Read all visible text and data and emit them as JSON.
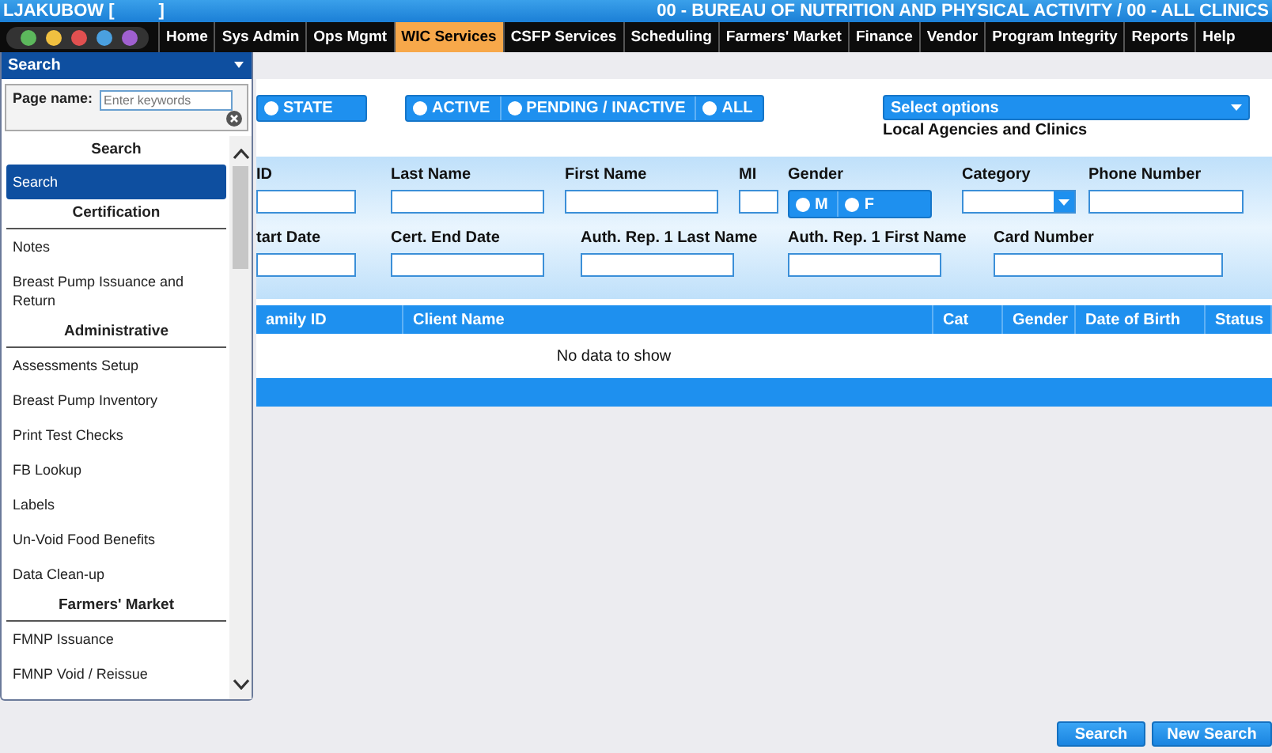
{
  "header": {
    "user": "LJAKUBOW [",
    "user_close": "]",
    "context": "00 - BUREAU OF NUTRITION AND PHYSICAL ACTIVITY / 00 - ALL CLINICS"
  },
  "nav": [
    {
      "label": "Home",
      "selected": false
    },
    {
      "label": "Sys Admin",
      "selected": false
    },
    {
      "label": "Ops Mgmt",
      "selected": false
    },
    {
      "label": "WIC Services",
      "selected": true
    },
    {
      "label": "CSFP Services",
      "selected": false
    },
    {
      "label": "Scheduling",
      "selected": false
    },
    {
      "label": "Farmers' Market",
      "selected": false
    },
    {
      "label": "Finance",
      "selected": false
    },
    {
      "label": "Vendor",
      "selected": false
    },
    {
      "label": "Program Integrity",
      "selected": false
    },
    {
      "label": "Reports",
      "selected": false
    },
    {
      "label": "Help",
      "selected": false
    }
  ],
  "menu_panel": {
    "title": "Search",
    "page_name_label": "Page name:",
    "page_name_placeholder": "Enter keywords",
    "items": [
      {
        "kind": "header",
        "label": "Search"
      },
      {
        "kind": "item",
        "label": "Search",
        "selected": true
      },
      {
        "kind": "header",
        "label": "Certification"
      },
      {
        "kind": "item",
        "label": "Notes",
        "selected": false
      },
      {
        "kind": "item",
        "label": "Breast Pump Issuance and Return",
        "selected": false
      },
      {
        "kind": "header",
        "label": "Administrative"
      },
      {
        "kind": "item",
        "label": "Assessments Setup",
        "selected": false
      },
      {
        "kind": "item",
        "label": "Breast Pump Inventory",
        "selected": false
      },
      {
        "kind": "item",
        "label": "Print Test Checks",
        "selected": false
      },
      {
        "kind": "item",
        "label": "FB Lookup",
        "selected": false
      },
      {
        "kind": "item",
        "label": "Labels",
        "selected": false
      },
      {
        "kind": "item",
        "label": "Un-Void Food Benefits",
        "selected": false
      },
      {
        "kind": "item",
        "label": "Data Clean-up",
        "selected": false
      },
      {
        "kind": "header",
        "label": "Farmers' Market"
      },
      {
        "kind": "item",
        "label": "FMNP Issuance",
        "selected": false
      },
      {
        "kind": "item",
        "label": "FMNP Void / Reissue",
        "selected": false
      }
    ]
  },
  "scope": [
    {
      "label": "STATE",
      "selected": false
    }
  ],
  "status_filter": [
    {
      "label": "ACTIVE",
      "selected": false
    },
    {
      "label": "PENDING / INACTIVE",
      "selected": false
    },
    {
      "label": "ALL",
      "selected": false
    }
  ],
  "agencies": {
    "value": "Select options",
    "label": "Local Agencies and Clinics"
  },
  "filter_row_1": [
    {
      "kind": "text",
      "label": "ID"
    },
    {
      "kind": "text",
      "label": "Last Name"
    },
    {
      "kind": "text",
      "label": "First Name"
    },
    {
      "kind": "text",
      "label": "MI"
    },
    {
      "kind": "radio",
      "label": "Gender",
      "options": [
        {
          "label": "M",
          "selected": false
        },
        {
          "label": "F",
          "selected": false
        }
      ]
    },
    {
      "kind": "select",
      "label": "Category"
    },
    {
      "kind": "text",
      "label": "Phone Number"
    }
  ],
  "filter_row_2": [
    {
      "kind": "text",
      "label": "tart Date"
    },
    {
      "kind": "text",
      "label": "Cert. End Date"
    },
    {
      "kind": "text",
      "label": "Auth. Rep. 1 Last Name"
    },
    {
      "kind": "text",
      "label": "Auth. Rep. 1 First Name"
    },
    {
      "kind": "text",
      "label": "Card Number"
    }
  ],
  "table": {
    "columns": [
      "amily ID",
      "Client Name",
      "Cat",
      "Gender",
      "Date of Birth",
      "Status"
    ],
    "empty_text": "No data to show"
  },
  "buttons": [
    "Search",
    "New Search"
  ]
}
